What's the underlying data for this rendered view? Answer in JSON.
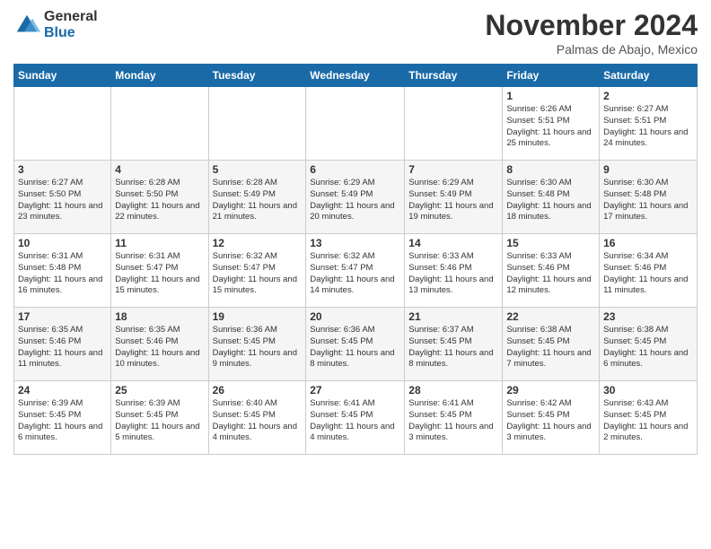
{
  "logo": {
    "general": "General",
    "blue": "Blue"
  },
  "header": {
    "month": "November 2024",
    "location": "Palmas de Abajo, Mexico"
  },
  "weekdays": [
    "Sunday",
    "Monday",
    "Tuesday",
    "Wednesday",
    "Thursday",
    "Friday",
    "Saturday"
  ],
  "weeks": [
    [
      {
        "day": "",
        "info": ""
      },
      {
        "day": "",
        "info": ""
      },
      {
        "day": "",
        "info": ""
      },
      {
        "day": "",
        "info": ""
      },
      {
        "day": "",
        "info": ""
      },
      {
        "day": "1",
        "info": "Sunrise: 6:26 AM\nSunset: 5:51 PM\nDaylight: 11 hours and 25 minutes."
      },
      {
        "day": "2",
        "info": "Sunrise: 6:27 AM\nSunset: 5:51 PM\nDaylight: 11 hours and 24 minutes."
      }
    ],
    [
      {
        "day": "3",
        "info": "Sunrise: 6:27 AM\nSunset: 5:50 PM\nDaylight: 11 hours and 23 minutes."
      },
      {
        "day": "4",
        "info": "Sunrise: 6:28 AM\nSunset: 5:50 PM\nDaylight: 11 hours and 22 minutes."
      },
      {
        "day": "5",
        "info": "Sunrise: 6:28 AM\nSunset: 5:49 PM\nDaylight: 11 hours and 21 minutes."
      },
      {
        "day": "6",
        "info": "Sunrise: 6:29 AM\nSunset: 5:49 PM\nDaylight: 11 hours and 20 minutes."
      },
      {
        "day": "7",
        "info": "Sunrise: 6:29 AM\nSunset: 5:49 PM\nDaylight: 11 hours and 19 minutes."
      },
      {
        "day": "8",
        "info": "Sunrise: 6:30 AM\nSunset: 5:48 PM\nDaylight: 11 hours and 18 minutes."
      },
      {
        "day": "9",
        "info": "Sunrise: 6:30 AM\nSunset: 5:48 PM\nDaylight: 11 hours and 17 minutes."
      }
    ],
    [
      {
        "day": "10",
        "info": "Sunrise: 6:31 AM\nSunset: 5:48 PM\nDaylight: 11 hours and 16 minutes."
      },
      {
        "day": "11",
        "info": "Sunrise: 6:31 AM\nSunset: 5:47 PM\nDaylight: 11 hours and 15 minutes."
      },
      {
        "day": "12",
        "info": "Sunrise: 6:32 AM\nSunset: 5:47 PM\nDaylight: 11 hours and 15 minutes."
      },
      {
        "day": "13",
        "info": "Sunrise: 6:32 AM\nSunset: 5:47 PM\nDaylight: 11 hours and 14 minutes."
      },
      {
        "day": "14",
        "info": "Sunrise: 6:33 AM\nSunset: 5:46 PM\nDaylight: 11 hours and 13 minutes."
      },
      {
        "day": "15",
        "info": "Sunrise: 6:33 AM\nSunset: 5:46 PM\nDaylight: 11 hours and 12 minutes."
      },
      {
        "day": "16",
        "info": "Sunrise: 6:34 AM\nSunset: 5:46 PM\nDaylight: 11 hours and 11 minutes."
      }
    ],
    [
      {
        "day": "17",
        "info": "Sunrise: 6:35 AM\nSunset: 5:46 PM\nDaylight: 11 hours and 11 minutes."
      },
      {
        "day": "18",
        "info": "Sunrise: 6:35 AM\nSunset: 5:46 PM\nDaylight: 11 hours and 10 minutes."
      },
      {
        "day": "19",
        "info": "Sunrise: 6:36 AM\nSunset: 5:45 PM\nDaylight: 11 hours and 9 minutes."
      },
      {
        "day": "20",
        "info": "Sunrise: 6:36 AM\nSunset: 5:45 PM\nDaylight: 11 hours and 8 minutes."
      },
      {
        "day": "21",
        "info": "Sunrise: 6:37 AM\nSunset: 5:45 PM\nDaylight: 11 hours and 8 minutes."
      },
      {
        "day": "22",
        "info": "Sunrise: 6:38 AM\nSunset: 5:45 PM\nDaylight: 11 hours and 7 minutes."
      },
      {
        "day": "23",
        "info": "Sunrise: 6:38 AM\nSunset: 5:45 PM\nDaylight: 11 hours and 6 minutes."
      }
    ],
    [
      {
        "day": "24",
        "info": "Sunrise: 6:39 AM\nSunset: 5:45 PM\nDaylight: 11 hours and 6 minutes."
      },
      {
        "day": "25",
        "info": "Sunrise: 6:39 AM\nSunset: 5:45 PM\nDaylight: 11 hours and 5 minutes."
      },
      {
        "day": "26",
        "info": "Sunrise: 6:40 AM\nSunset: 5:45 PM\nDaylight: 11 hours and 4 minutes."
      },
      {
        "day": "27",
        "info": "Sunrise: 6:41 AM\nSunset: 5:45 PM\nDaylight: 11 hours and 4 minutes."
      },
      {
        "day": "28",
        "info": "Sunrise: 6:41 AM\nSunset: 5:45 PM\nDaylight: 11 hours and 3 minutes."
      },
      {
        "day": "29",
        "info": "Sunrise: 6:42 AM\nSunset: 5:45 PM\nDaylight: 11 hours and 3 minutes."
      },
      {
        "day": "30",
        "info": "Sunrise: 6:43 AM\nSunset: 5:45 PM\nDaylight: 11 hours and 2 minutes."
      }
    ]
  ]
}
